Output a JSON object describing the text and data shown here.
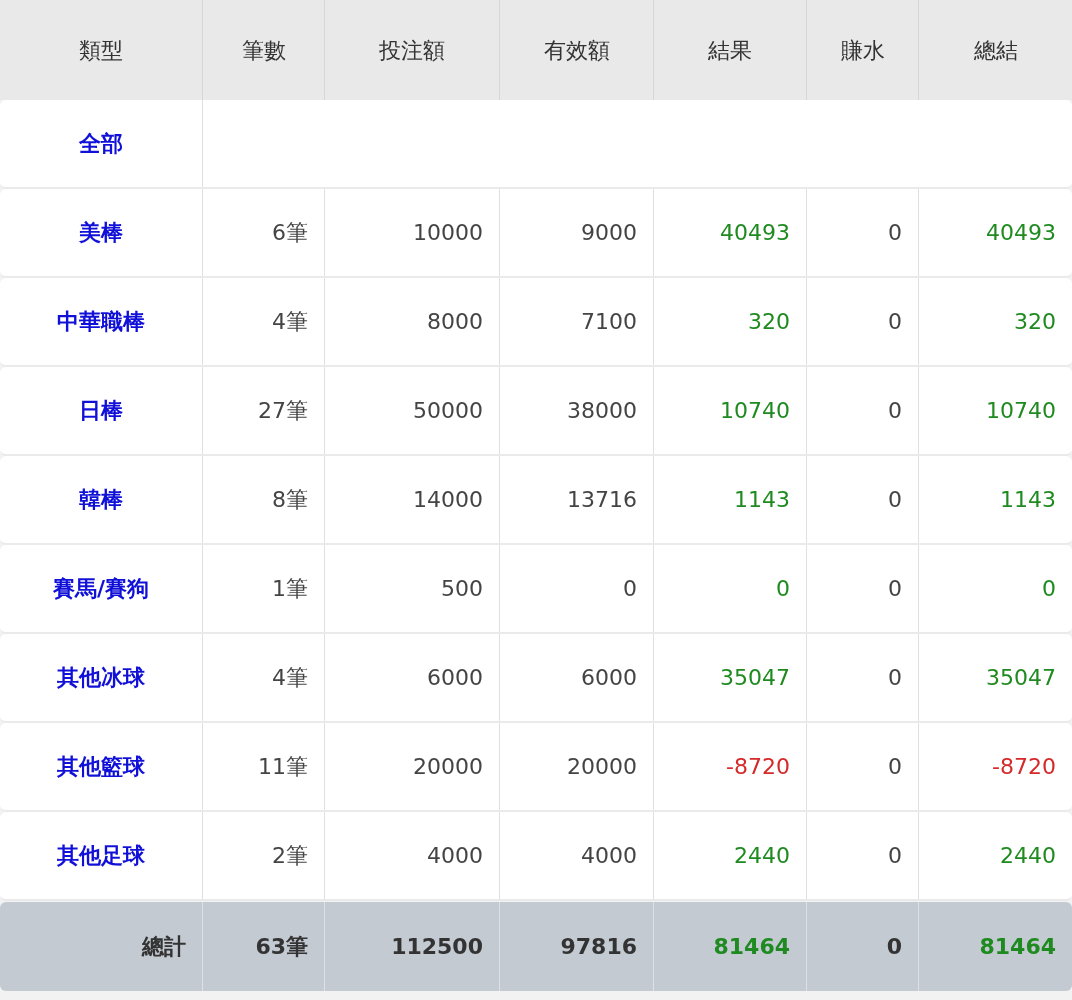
{
  "table": {
    "columns": [
      "類型",
      "筆數",
      "投注額",
      "有效額",
      "結果",
      "賺水",
      "總結"
    ],
    "rows": [
      {
        "type": "全部"
      },
      {
        "type": "美棒",
        "count": "6筆",
        "bet": "10000",
        "valid": "9000",
        "result": "40493",
        "commission": "0",
        "total": "40493",
        "color": "#1f8a1f"
      },
      {
        "type": "中華職棒",
        "count": "4筆",
        "bet": "8000",
        "valid": "7100",
        "result": "320",
        "commission": "0",
        "total": "320",
        "color": "#1f8a1f"
      },
      {
        "type": "日棒",
        "count": "27筆",
        "bet": "50000",
        "valid": "38000",
        "result": "10740",
        "commission": "0",
        "total": "10740",
        "color": "#1f8a1f"
      },
      {
        "type": "韓棒",
        "count": "8筆",
        "bet": "14000",
        "valid": "13716",
        "result": "1143",
        "commission": "0",
        "total": "1143",
        "color": "#1f8a1f"
      },
      {
        "type": "賽馬/賽狗",
        "count": "1筆",
        "bet": "500",
        "valid": "0",
        "result": "0",
        "commission": "0",
        "total": "0",
        "color": "#1f8a1f"
      },
      {
        "type": "其他冰球",
        "count": "4筆",
        "bet": "6000",
        "valid": "6000",
        "result": "35047",
        "commission": "0",
        "total": "35047",
        "color": "#1f8a1f"
      },
      {
        "type": "其他籃球",
        "count": "11筆",
        "bet": "20000",
        "valid": "20000",
        "result": "-8720",
        "commission": "0",
        "total": "-8720",
        "color": "#d42a2a"
      },
      {
        "type": "其他足球",
        "count": "2筆",
        "bet": "4000",
        "valid": "4000",
        "result": "2440",
        "commission": "0",
        "total": "2440",
        "color": "#1f8a1f"
      }
    ],
    "footer": {
      "label": "總計",
      "count": "63筆",
      "bet": "112500",
      "valid": "97816",
      "result": "81464",
      "commission": "0",
      "total": "81464",
      "color": "#1f8a1f"
    }
  }
}
